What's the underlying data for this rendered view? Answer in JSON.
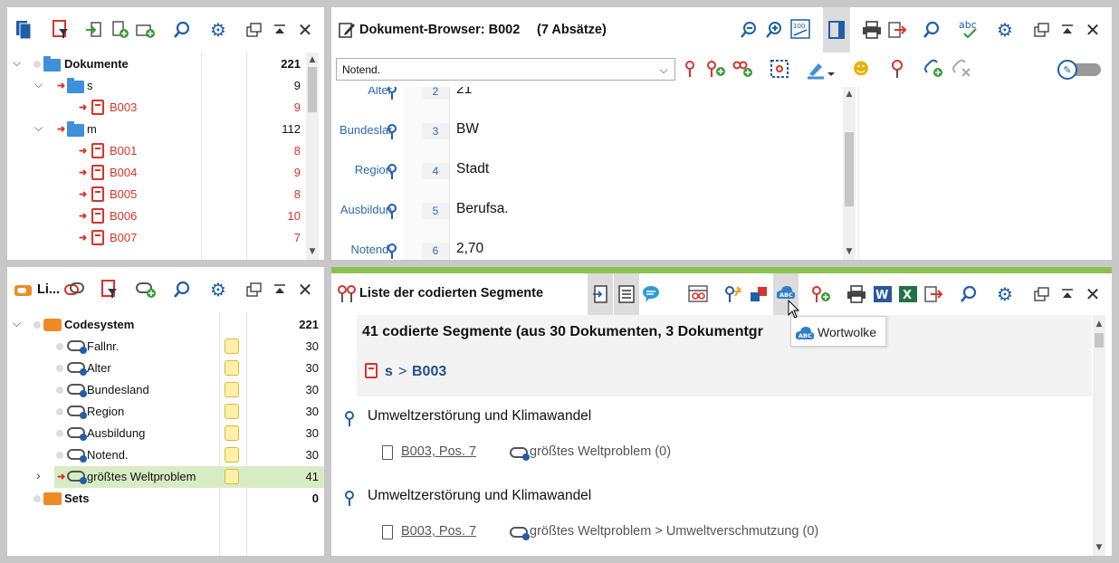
{
  "documents_pane": {
    "tree": [
      {
        "label": "Dokumente",
        "count": "221",
        "level": 0,
        "bold": true,
        "type": "root"
      },
      {
        "label": "s",
        "count": "9",
        "level": 1,
        "type": "group"
      },
      {
        "label": "B003",
        "count": "9",
        "level": 2,
        "type": "doc"
      },
      {
        "label": "m",
        "count": "112",
        "level": 1,
        "type": "group"
      },
      {
        "label": "B001",
        "count": "8",
        "level": 2,
        "type": "doc"
      },
      {
        "label": "B004",
        "count": "9",
        "level": 2,
        "type": "doc"
      },
      {
        "label": "B005",
        "count": "8",
        "level": 2,
        "type": "doc"
      },
      {
        "label": "B006",
        "count": "10",
        "level": 2,
        "type": "doc"
      },
      {
        "label": "B007",
        "count": "7",
        "level": 2,
        "type": "doc"
      }
    ]
  },
  "codes_pane": {
    "title": "Li...",
    "tree": [
      {
        "label": "Codesystem",
        "count": "221",
        "bold": true,
        "type": "root"
      },
      {
        "label": "Fallnr.",
        "count": "30",
        "type": "code"
      },
      {
        "label": "Alter",
        "count": "30",
        "type": "code"
      },
      {
        "label": "Bundesland",
        "count": "30",
        "type": "code"
      },
      {
        "label": "Region",
        "count": "30",
        "type": "code"
      },
      {
        "label": "Ausbildung",
        "count": "30",
        "type": "code"
      },
      {
        "label": "Notend.",
        "count": "30",
        "type": "code"
      },
      {
        "label": "größtes Weltproblem",
        "count": "41",
        "type": "code",
        "selected": true
      },
      {
        "label": "Sets",
        "count": "0",
        "bold": true,
        "type": "sets"
      }
    ]
  },
  "document_browser": {
    "title": "Dokument-Browser: B002",
    "subtitle": "(7 Absätze)",
    "code_select": "Notend.",
    "paragraphs": [
      {
        "code": "Alter",
        "num": "2",
        "text": "21"
      },
      {
        "code": "Bundeslan",
        "num": "3",
        "text": "BW"
      },
      {
        "code": "Region",
        "num": "4",
        "text": "Stadt"
      },
      {
        "code": "Ausbildun",
        "num": "5",
        "text": "Berufsa."
      },
      {
        "code": "Notend.",
        "num": "6",
        "text": "2,70"
      }
    ]
  },
  "segments_pane": {
    "title": "Liste der codierten Segmente",
    "summary": "41 codierte Segmente (aus 30 Dokumenten, 3 Dokumentgr",
    "group_path_1": "s",
    "group_sep": ">",
    "group_path_2": "B003",
    "tooltip": "Wortwolke",
    "segments": [
      {
        "text": "Umweltzerstörung und Klimawandel",
        "doc": "B003, Pos. 7",
        "code": "größtes Weltproblem (0)"
      },
      {
        "text": "Umweltzerstörung und Klimawandel",
        "doc": "B003, Pos. 7",
        "code": "größtes Weltproblem > Umweltverschmutzung (0)"
      }
    ]
  },
  "colors": {
    "accent_green": "#8cc152",
    "doc_red": "#d9332a",
    "folder_blue": "#3f8fdc",
    "code_blue": "#1f5fa8"
  }
}
